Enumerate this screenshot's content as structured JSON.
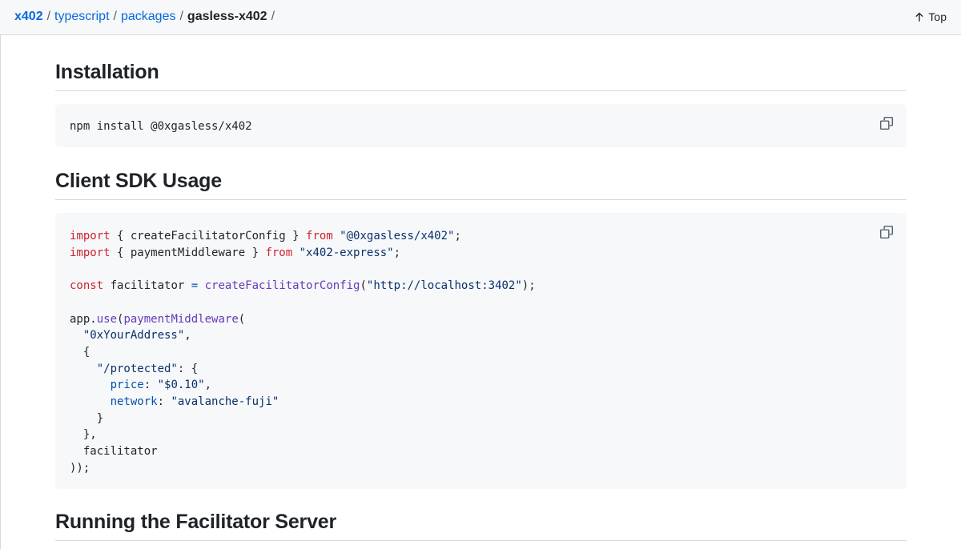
{
  "breadcrumb": {
    "items": [
      "x402",
      "typescript",
      "packages"
    ],
    "current": "gasless-x402",
    "separator": "/"
  },
  "top_link": {
    "label": "Top",
    "icon": "arrow-up-icon"
  },
  "sections": {
    "installation": {
      "heading": "Installation",
      "code": "npm install @0xgasless/x402"
    },
    "client": {
      "heading": "Client SDK Usage",
      "code_lines": [
        [
          [
            "kw",
            "import"
          ],
          [
            "t",
            " { createFacilitatorConfig } "
          ],
          [
            "kw",
            "from"
          ],
          [
            "t",
            " "
          ],
          [
            "str",
            "\"@0xgasless/x402\""
          ],
          [
            "t",
            ";"
          ]
        ],
        [
          [
            "kw",
            "import"
          ],
          [
            "t",
            " { paymentMiddleware } "
          ],
          [
            "kw",
            "from"
          ],
          [
            "t",
            " "
          ],
          [
            "str",
            "\"x402-express\""
          ],
          [
            "t",
            ";"
          ]
        ],
        [],
        [
          [
            "kw",
            "const"
          ],
          [
            "t",
            " facilitator "
          ],
          [
            "op",
            "="
          ],
          [
            "t",
            " "
          ],
          [
            "fn",
            "createFacilitatorConfig"
          ],
          [
            "t",
            "("
          ],
          [
            "str",
            "\"http://localhost:3402\""
          ],
          [
            "t",
            ");"
          ]
        ],
        [],
        [
          [
            "t",
            "app."
          ],
          [
            "fn",
            "use"
          ],
          [
            "t",
            "("
          ],
          [
            "fn",
            "paymentMiddleware"
          ],
          [
            "t",
            "("
          ]
        ],
        [
          [
            "t",
            "  "
          ],
          [
            "str",
            "\"0xYourAddress\""
          ],
          [
            "t",
            ","
          ]
        ],
        [
          [
            "t",
            "  {"
          ]
        ],
        [
          [
            "t",
            "    "
          ],
          [
            "str",
            "\"/protected\""
          ],
          [
            "t",
            ": {"
          ]
        ],
        [
          [
            "t",
            "      "
          ],
          [
            "prop",
            "price"
          ],
          [
            "t",
            ": "
          ],
          [
            "str",
            "\"$0.10\""
          ],
          [
            "t",
            ","
          ]
        ],
        [
          [
            "t",
            "      "
          ],
          [
            "prop",
            "network"
          ],
          [
            "t",
            ": "
          ],
          [
            "str",
            "\"avalanche-fuji\""
          ]
        ],
        [
          [
            "t",
            "    }"
          ]
        ],
        [
          [
            "t",
            "  },"
          ]
        ],
        [
          [
            "t",
            "  facilitator"
          ]
        ],
        [
          [
            "t",
            "));"
          ]
        ]
      ]
    },
    "running": {
      "heading": "Running the Facilitator Server"
    }
  },
  "icons": {
    "copy": "copy-icon",
    "arrow_up": "arrow-up-icon"
  },
  "colors": {
    "link": "#0969da",
    "keyword": "#cf222e",
    "string": "#0a3069",
    "function": "#6639ba",
    "property": "#0550ae",
    "code_bg": "#f6f8fa"
  }
}
